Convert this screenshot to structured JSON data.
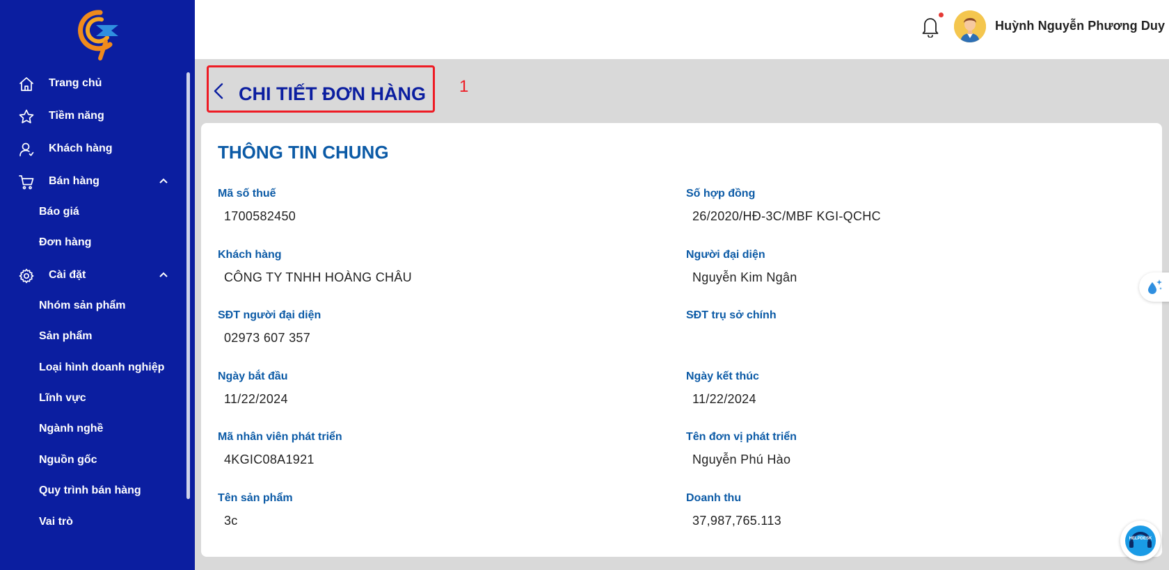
{
  "sidebar": {
    "items": [
      {
        "label": "Trang chủ",
        "icon": "home-icon"
      },
      {
        "label": "Tiềm năng",
        "icon": "star-icon"
      },
      {
        "label": "Khách hàng",
        "icon": "user-icon"
      },
      {
        "label": "Bán hàng",
        "icon": "cart-icon",
        "expanded": true
      },
      {
        "label": "Báo giá"
      },
      {
        "label": "Đơn hàng"
      },
      {
        "label": "Cài đặt",
        "icon": "gear-icon",
        "expanded": true
      },
      {
        "label": "Nhóm sản phẩm"
      },
      {
        "label": "Sản phẩm"
      },
      {
        "label": "Loại hình doanh nghiệp"
      },
      {
        "label": "Lĩnh vực"
      },
      {
        "label": "Ngành nghề"
      },
      {
        "label": "Nguồn gốc"
      },
      {
        "label": "Quy trình bán hàng"
      },
      {
        "label": "Vai trò"
      }
    ]
  },
  "header": {
    "user_name": "Huỳnh Nguyễn Phương Duy",
    "has_notification": true
  },
  "page": {
    "title": "CHI TIẾT ĐƠN HÀNG",
    "step_number": "1"
  },
  "section": {
    "title": "THÔNG TIN CHUNG",
    "fields": [
      {
        "label": "Mã số thuế",
        "value": "1700582450"
      },
      {
        "label": "Số hợp đồng",
        "value": "26/2020/HĐ-3C/MBF KGI-QCHC"
      },
      {
        "label": "Khách hàng",
        "value": "CÔNG TY TNHH HOÀNG CHÂU"
      },
      {
        "label": "Người đại diện",
        "value": "Nguyễn Kim Ngân"
      },
      {
        "label": "SĐT người đại diện",
        "value": "02973 607 357"
      },
      {
        "label": "SĐT trụ sở chính",
        "value": ""
      },
      {
        "label": "Ngày bắt đầu",
        "value": "11/22/2024"
      },
      {
        "label": "Ngày kết thúc",
        "value": "11/22/2024"
      },
      {
        "label": "Mã nhân viên phát triển",
        "value": "4KGIC08A1921"
      },
      {
        "label": "Tên đơn vị phát triển",
        "value": "Nguyễn Phú Hào"
      },
      {
        "label": "Tên sản phẩm",
        "value": "3c"
      },
      {
        "label": "Doanh thu",
        "value": "37,987,765.113"
      }
    ]
  },
  "helpdesk": {
    "label": "HELPDESK"
  },
  "colors": {
    "sidebar": "#0b1ea0",
    "label": "#0b5aa6",
    "highlight": "#ee1b24"
  }
}
